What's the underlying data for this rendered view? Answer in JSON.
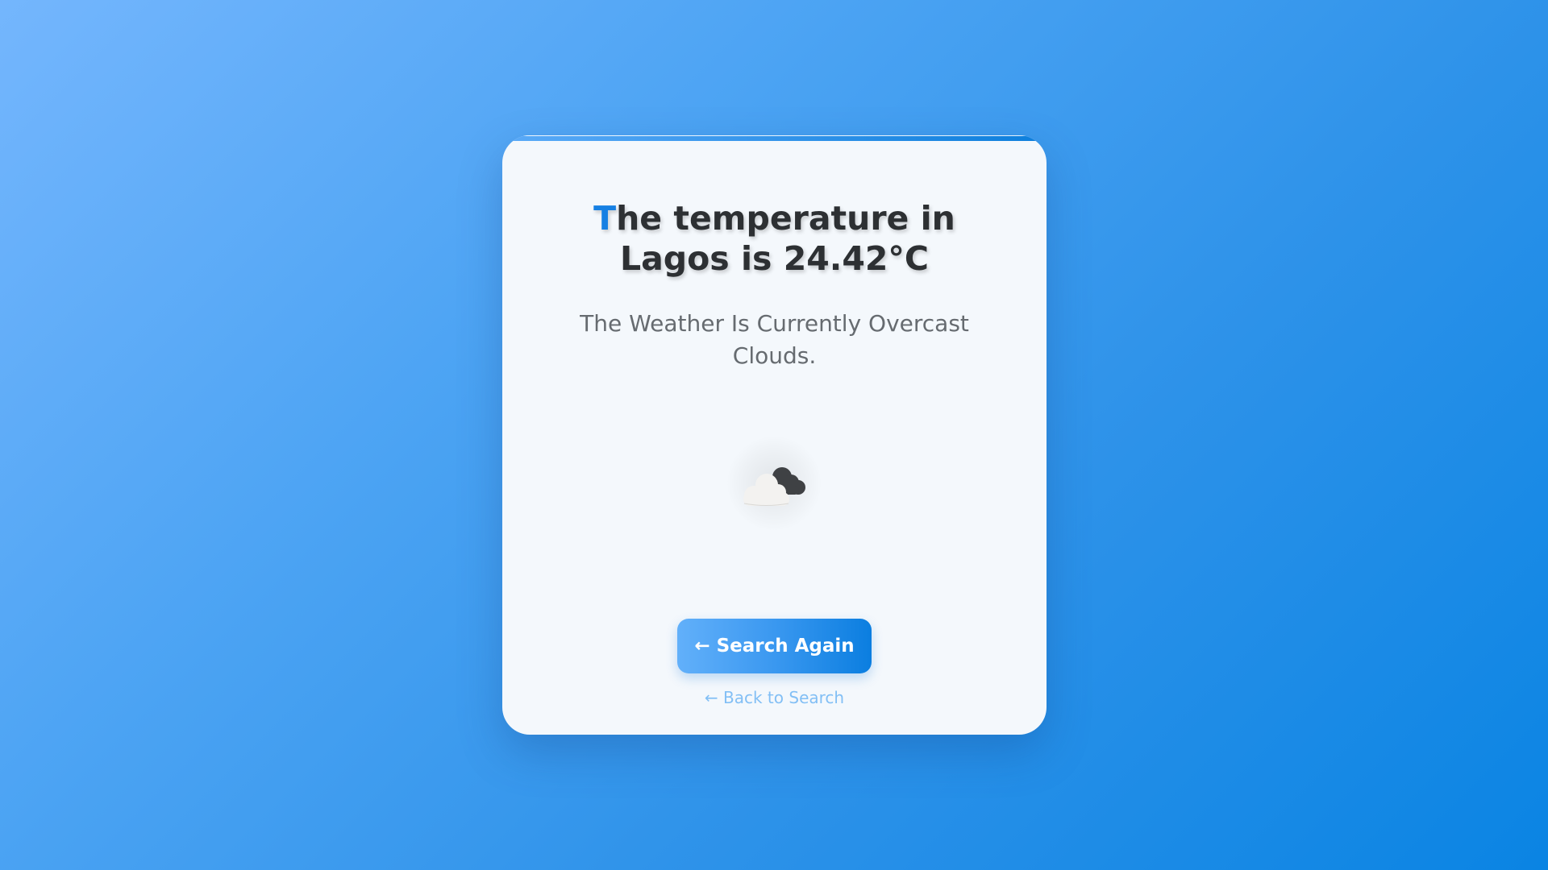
{
  "card": {
    "title_first_letter": "T",
    "title_rest": "he temperature in Lagos is 24.42°C",
    "description": "The Weather Is Currently Overcast Clouds.",
    "weather_icon": "overcast-clouds-icon"
  },
  "actions": {
    "primary_arrow": "←",
    "primary_label": "Search Again",
    "back_link": "← Back to Search"
  },
  "colors": {
    "accent": "#1680e3",
    "button_gradient_start": "#62b0fa",
    "button_gradient_end": "#0b7ee0",
    "link": "#82bff5",
    "card_background": "#f4f8fc"
  }
}
